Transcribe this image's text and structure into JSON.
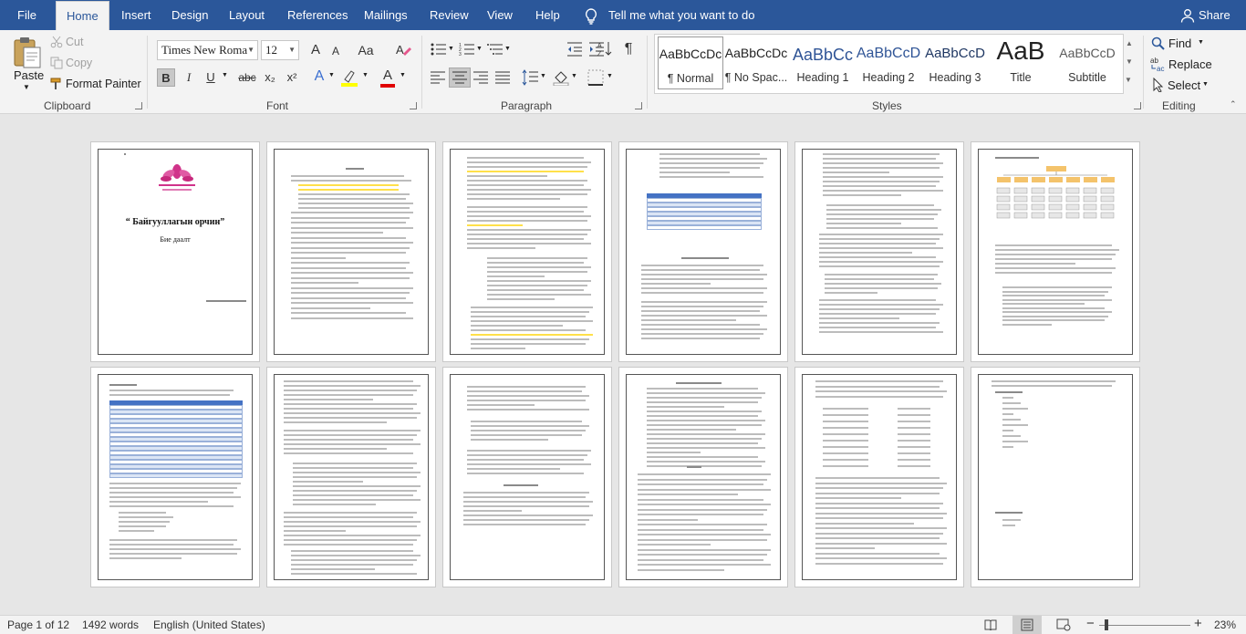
{
  "tabs": [
    "File",
    "Home",
    "Insert",
    "Design",
    "Layout",
    "References",
    "Mailings",
    "Review",
    "View",
    "Help"
  ],
  "active_tab": "Home",
  "tell_me": "Tell me what you want to do",
  "share": "Share",
  "clipboard": {
    "paste": "Paste",
    "cut": "Cut",
    "copy": "Copy",
    "format_painter": "Format Painter",
    "label": "Clipboard"
  },
  "font": {
    "name": "Times New Roma",
    "size": "12",
    "label": "Font",
    "grow": "A",
    "shrink": "A",
    "case": "Aa",
    "bold": "B",
    "italic": "I",
    "underline": "U",
    "strike": "abc",
    "sub": "x₂",
    "sup": "x²",
    "effects": "A",
    "color": "A"
  },
  "paragraph": {
    "label": "Paragraph",
    "pilcrow": "¶"
  },
  "styles": {
    "label": "Styles",
    "items": [
      {
        "preview": "AaBbCcDc",
        "name": "¶ Normal",
        "color": "#222",
        "size": "14px"
      },
      {
        "preview": "AaBbCcDc",
        "name": "¶ No Spac...",
        "color": "#222",
        "size": "14px"
      },
      {
        "preview": "AaBbCc",
        "name": "Heading 1",
        "color": "#2f5496",
        "size": "18px"
      },
      {
        "preview": "AaBbCcD",
        "name": "Heading 2",
        "color": "#2f5496",
        "size": "16px"
      },
      {
        "preview": "AaBbCcD",
        "name": "Heading 3",
        "color": "#1f3763",
        "size": "15px"
      },
      {
        "preview": "AaB",
        "name": "Title",
        "color": "#222",
        "size": "28px"
      },
      {
        "preview": "AaBbCcD",
        "name": "Subtitle",
        "color": "#595959",
        "size": "14px"
      }
    ]
  },
  "editing": {
    "label": "Editing",
    "find": "Find",
    "replace": "Replace",
    "select": "Select"
  },
  "doc": {
    "cover_title": "“ Байгууллагын орчин”",
    "cover_subtitle": "Бие даалт"
  },
  "status": {
    "page": "Page 1 of 12",
    "words": "1492 words",
    "language": "English (United States)",
    "zoom": "23%"
  },
  "colors": {
    "accent": "#2b579a",
    "ribbon": "#f3f3f3",
    "workspace": "#e6e6e6"
  }
}
